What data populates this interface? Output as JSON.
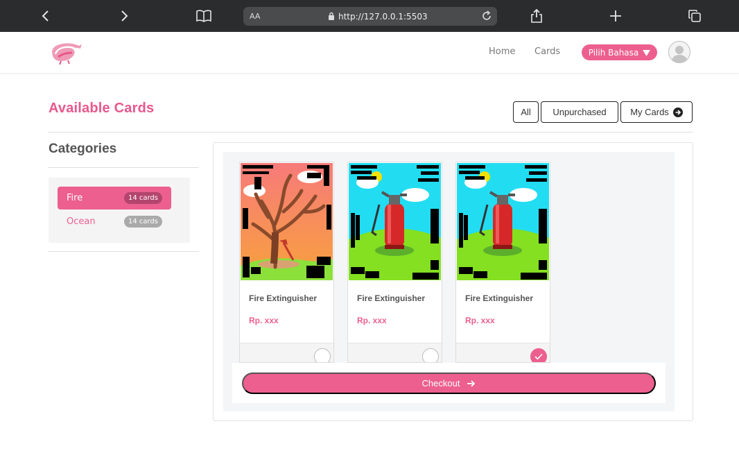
{
  "browser": {
    "text_size_label": "AA",
    "url": "http://127.0.0.1:5503"
  },
  "header": {
    "nav": {
      "home": "Home",
      "cards": "Cards"
    },
    "language_button": "Pilih Bahasa"
  },
  "page": {
    "title": "Available Cards",
    "filters": {
      "all": "All",
      "unpurchased": "Unpurchased",
      "my_cards": "My Cards"
    }
  },
  "sidebar": {
    "title": "Categories",
    "items": [
      {
        "label": "Fire",
        "count": "14 cards",
        "active": true
      },
      {
        "label": "Ocean",
        "count": "14 cards",
        "active": false
      }
    ]
  },
  "cards": [
    {
      "name": "Fire Extinguisher",
      "price": "Rp. xxx",
      "selected": false,
      "art": "burnt-tree"
    },
    {
      "name": "Fire Extinguisher",
      "price": "Rp. xxx",
      "selected": false,
      "art": "fire-extinguisher"
    },
    {
      "name": "Fire Extinguisher",
      "price": "Rp. xxx",
      "selected": true,
      "art": "fire-extinguisher"
    }
  ],
  "checkout_label": "Checkout",
  "colors": {
    "accent": "#ec5f8f",
    "chrome": "#2b2c2e"
  }
}
